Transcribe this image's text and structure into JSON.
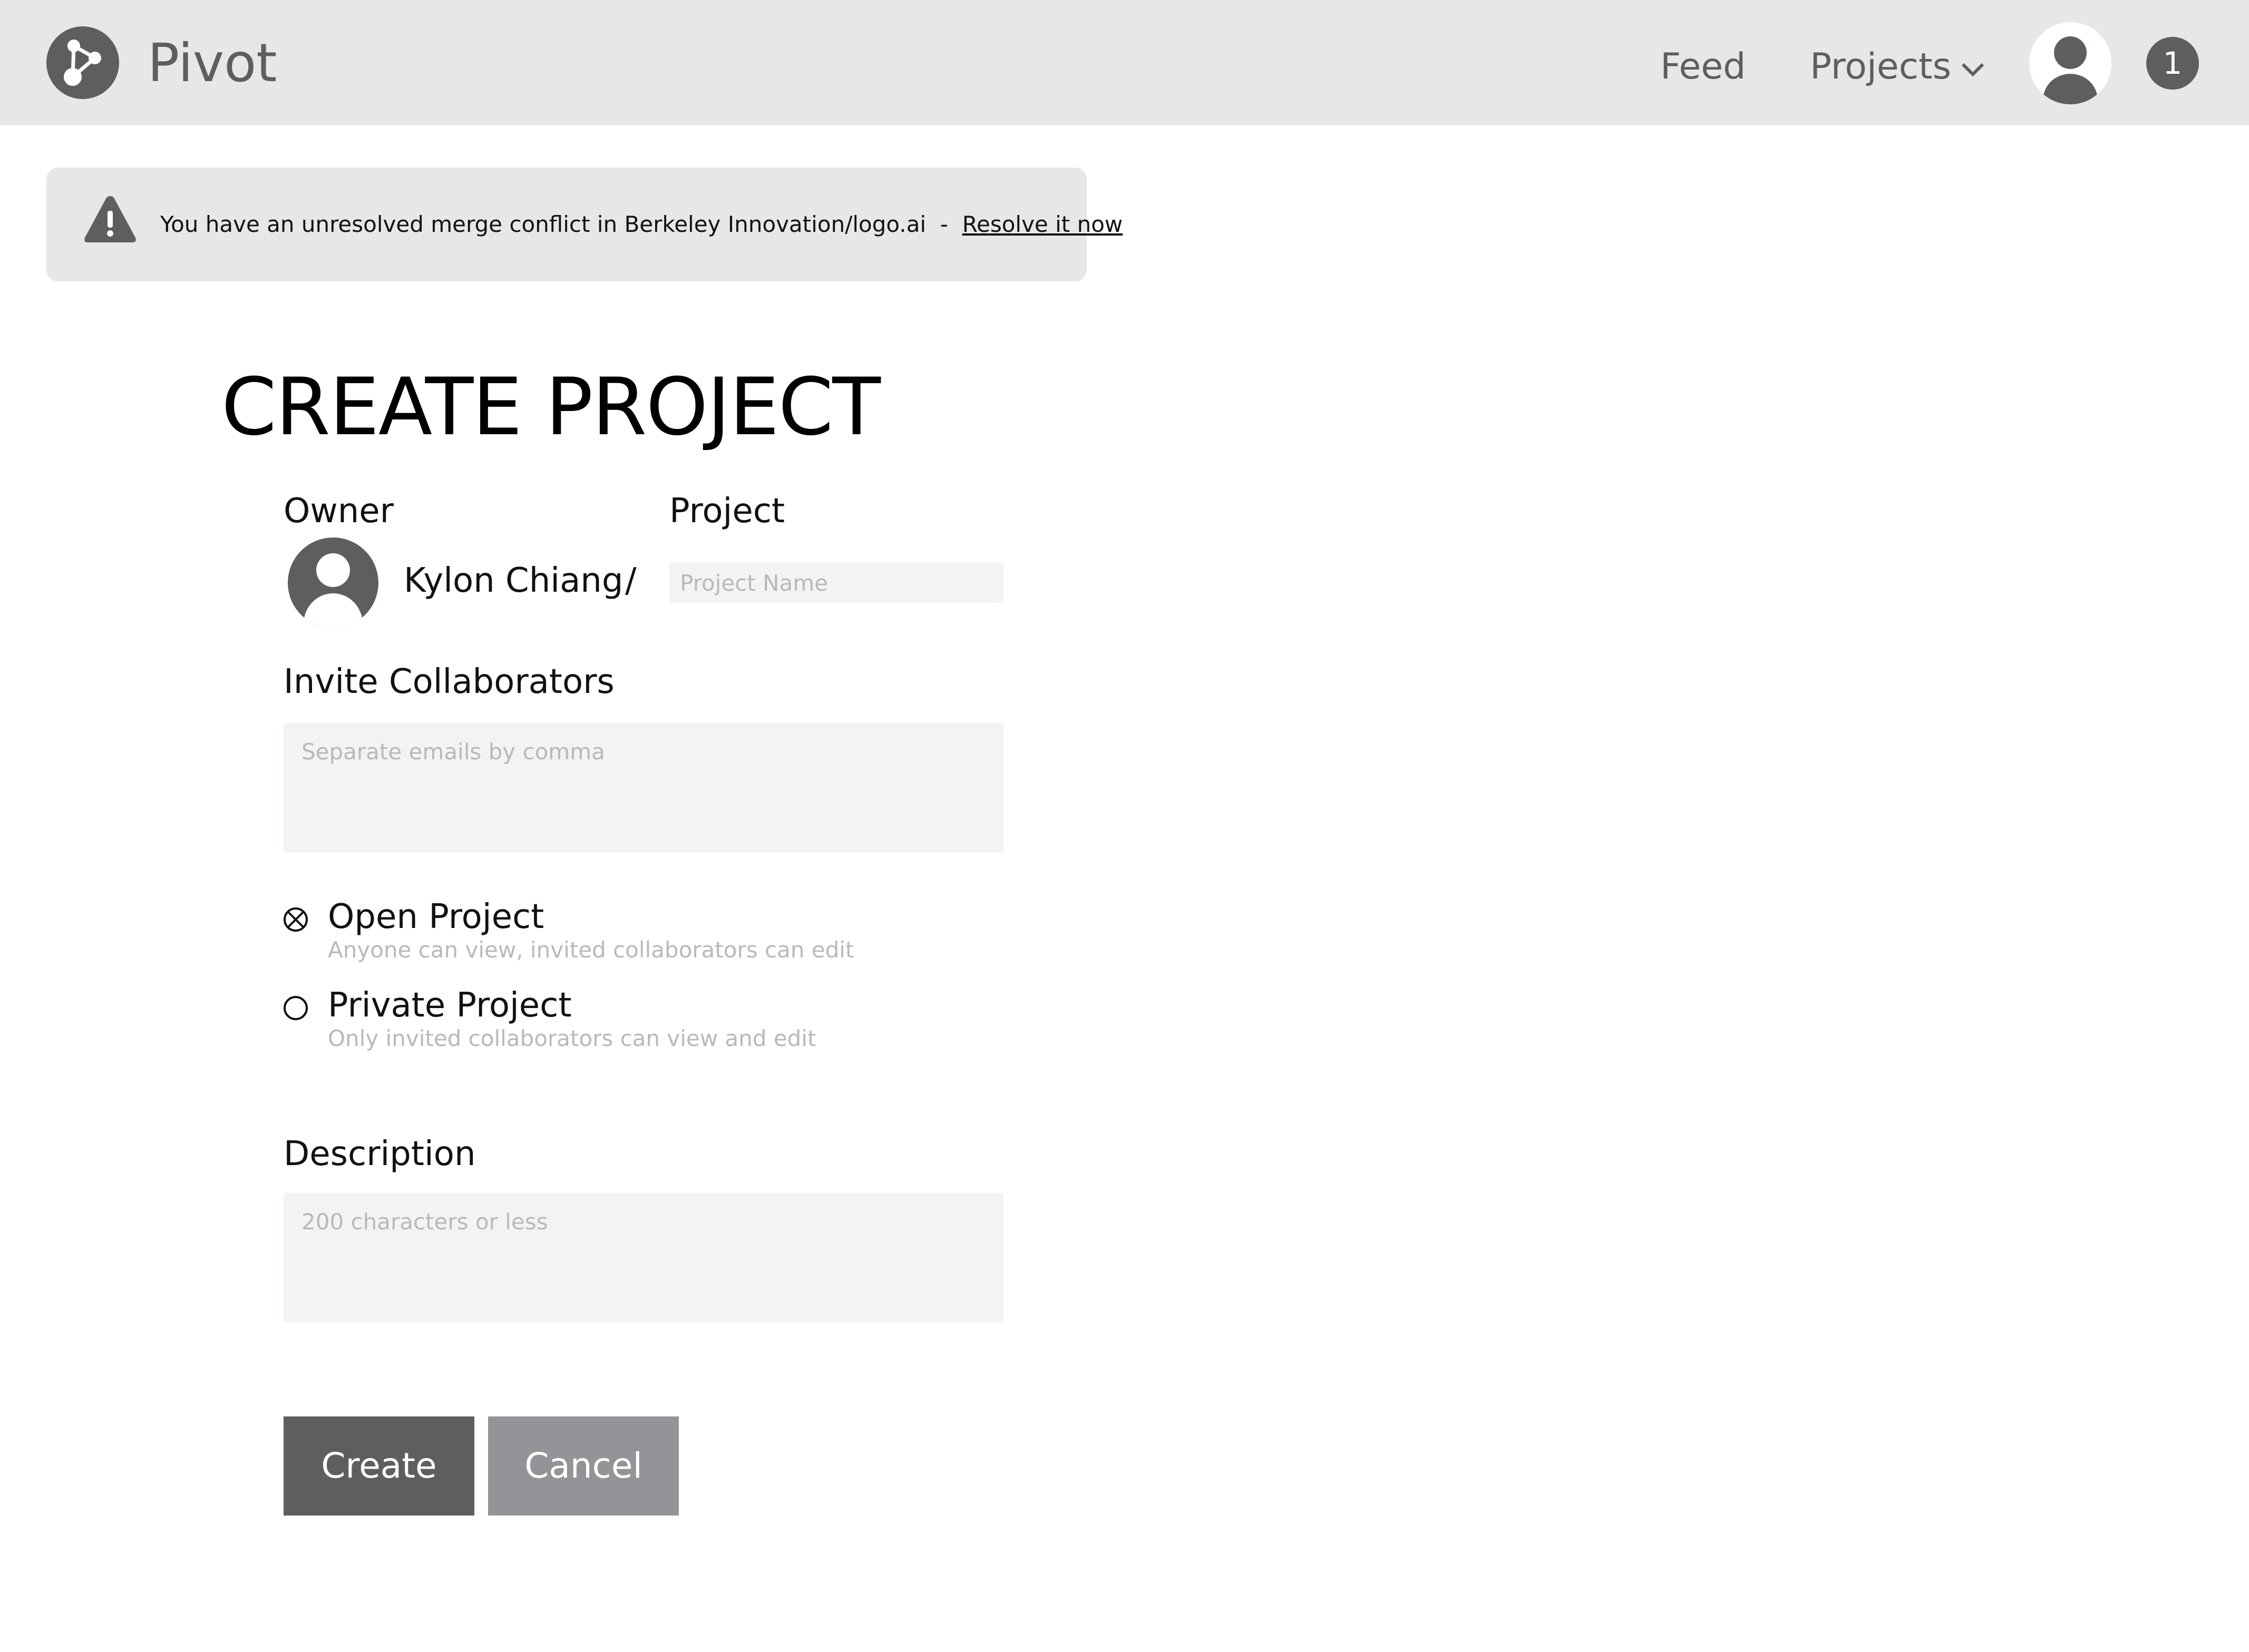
{
  "header": {
    "brand": "Pivot",
    "nav": {
      "feed": "Feed",
      "projects": "Projects"
    },
    "notification_count": "1"
  },
  "alert": {
    "message": "You have an unresolved merge conflict in Berkeley Innovation/logo.ai",
    "separator": "-",
    "link_label": "Resolve it now"
  },
  "form": {
    "title": "CREATE PROJECT",
    "owner_label": "Owner",
    "project_label": "Project",
    "owner_name": "Kylon Chiang",
    "slash": "/",
    "project_name_placeholder": "Project Name",
    "collaborators_label": "Invite Collaborators",
    "collaborators_placeholder": "Separate emails by comma",
    "visibility": {
      "selected": "open",
      "options": [
        {
          "id": "open",
          "title": "Open Project",
          "subtitle": "Anyone can view, invited collaborators can edit"
        },
        {
          "id": "private",
          "title": "Private Project",
          "subtitle": "Only invited collaborators can view and edit"
        }
      ]
    },
    "description_label": "Description",
    "description_placeholder": "200 characters or less",
    "create_label": "Create",
    "cancel_label": "Cancel"
  },
  "icons": {
    "logo": "share-icon",
    "header_avatar": "user-avatar-icon",
    "alert": "warning-icon",
    "owner_avatar": "user-avatar-icon",
    "projects_dropdown": "chevron-down-icon",
    "radio_open": "radio-checked-x-icon",
    "radio_private": "radio-empty-icon"
  },
  "colors": {
    "header_bg": "#e6e7e8",
    "dark_gray": "#5d5e60",
    "input_bg": "#f2f3f3",
    "cancel_bg": "#939497",
    "placeholder": "#b8b9bb"
  }
}
